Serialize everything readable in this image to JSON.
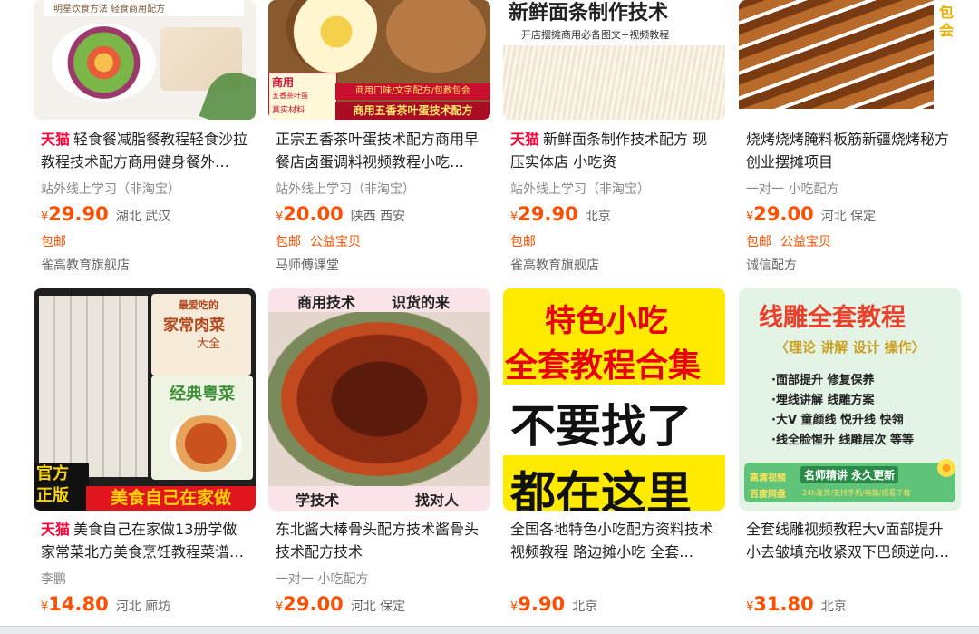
{
  "products": [
    {
      "tmall": "天猫",
      "title": "轻食餐减脂餐教程轻食沙拉教程技术配方商用健身餐外…",
      "sub": "站外线上学习（非淘宝）",
      "currency": "¥",
      "price": "29.90",
      "location": "湖北 武汉",
      "tags": [
        "包邮"
      ],
      "shop": "雀高教育旗舰店",
      "image_text": [
        "明星饮食方法 轻食商用配方"
      ]
    },
    {
      "tmall": "",
      "title": "正宗五香茶叶蛋技术配方商用早餐店卤蛋调料视频教程小吃…",
      "sub": "站外线上学习（非淘宝）",
      "currency": "¥",
      "price": "20.00",
      "location": "陕西 西安",
      "tags": [
        "包邮",
        "公益宝贝"
      ],
      "shop": "马师傅课堂",
      "image_text": [
        "商用",
        "五香茶叶蛋",
        "真实材料",
        "商用口味/文字配方/包教包会",
        "商用五香茶叶蛋技术配方"
      ]
    },
    {
      "tmall": "天猫",
      "title": "新鲜面条制作技术配方 现压实体店 小吃资",
      "sub": "站外线上学习（非淘宝）",
      "currency": "¥",
      "price": "29.90",
      "location": "北京",
      "tags": [
        "包邮"
      ],
      "shop": "雀高教育旗舰店",
      "image_text": [
        "新鲜面条制作技术",
        "开店摆摊商用必备图文+视频教程"
      ]
    },
    {
      "tmall": "",
      "title": "烧烤烧烤腌料板筋新疆烧烤秘方创业摆摊项目",
      "sub": "一对一  小吃配方",
      "currency": "¥",
      "price": "29.00",
      "location": "河北 保定",
      "tags": [
        "包邮",
        "公益宝贝"
      ],
      "shop": "诚信配方",
      "image_text": [
        "包",
        "会"
      ]
    },
    {
      "tmall": "天猫",
      "title": "美食自己在家做13册学做家常菜北方美食烹饪教程菜谱…",
      "sub": "李鹏",
      "currency": "¥",
      "price": "14.80",
      "location": "河北 廊坊",
      "tags": [],
      "shop": "",
      "image_text": [
        "最爱吃的",
        "家常肉菜",
        "大全",
        "经典粤菜",
        "官方",
        "正版",
        "美食自己在家做"
      ]
    },
    {
      "tmall": "",
      "title": "东北酱大棒骨头配方技术酱骨头技术配方技术",
      "sub": "一对一  小吃配方",
      "currency": "¥",
      "price": "29.00",
      "location": "河北 保定",
      "tags": [],
      "shop": "",
      "image_text": [
        "商用技术",
        "识货的来",
        "学技术",
        "找对人"
      ]
    },
    {
      "tmall": "",
      "title": "全国各地特色小吃配方资料技术视频教程 路边摊小吃 全套…",
      "sub": "",
      "currency": "¥",
      "price": "9.90",
      "location": "北京",
      "tags": [],
      "shop": "",
      "image_text": [
        "特色小吃",
        "全套教程合集",
        "不要找了",
        "都在这里"
      ]
    },
    {
      "tmall": "",
      "title": "全套线雕视频教程大v面部提升小去皱填充收紧双下巴颌逆向…",
      "sub": "",
      "currency": "¥",
      "price": "31.80",
      "location": "北京",
      "tags": [],
      "shop": "",
      "image_text": [
        "线雕全套教程",
        "〈理论 讲解 设计 操作〉",
        "·面部提升 修复保养",
        "·埋线讲解 线雕方案",
        "·大V 童颜线 悦升线 快翎",
        "·线全脸惺升 线雕层次 等等",
        "高清视频",
        "百度网盘",
        "名师精讲 永久更新",
        "24h发货/支持手机/电脑/观看下载"
      ]
    }
  ],
  "colors": {
    "price": "#ff5000",
    "tmall": "#ff0036"
  }
}
